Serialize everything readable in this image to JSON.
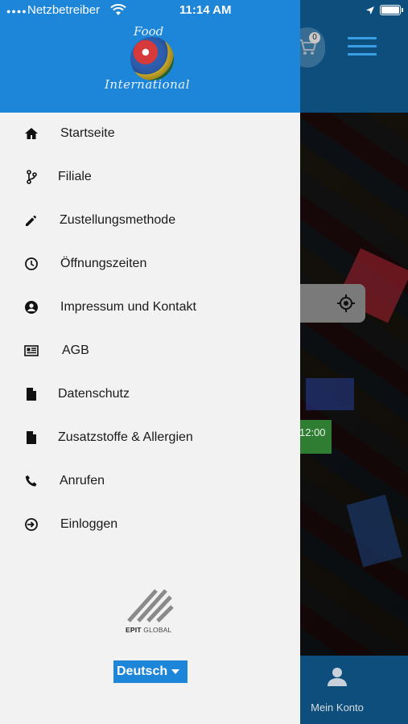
{
  "status_bar": {
    "carrier": "Netzbetreiber",
    "time": "11:14 AM"
  },
  "brand": {
    "logo_top": "Food",
    "logo_bottom": "International"
  },
  "menu": {
    "items": [
      {
        "label": "Startseite",
        "icon": "home-icon"
      },
      {
        "label": "Filiale",
        "icon": "branch-icon"
      },
      {
        "label": "Zustellungsmethode",
        "icon": "pencil-icon"
      },
      {
        "label": "Öffnungszeiten",
        "icon": "clock-icon"
      },
      {
        "label": "Impressum und Kontakt",
        "icon": "account-circle-icon"
      },
      {
        "label": "AGB",
        "icon": "newspaper-icon"
      },
      {
        "label": "Datenschutz",
        "icon": "document-icon"
      },
      {
        "label": "Zusatzstoffe & Allergien",
        "icon": "document-icon"
      },
      {
        "label": "Anrufen",
        "icon": "phone-icon"
      },
      {
        "label": "Einloggen",
        "icon": "login-icon"
      }
    ]
  },
  "footer": {
    "company_bold": "EPIT",
    "company_rest": " GLOBAL",
    "language": "Deutsch"
  },
  "background_app": {
    "cart_count": "0",
    "time_badge": "12:00",
    "account_label": "Mein Konto"
  },
  "colors": {
    "drawer_header": "#1e86d8",
    "drawer_bg": "#f2f2f2",
    "bottom_bar": "#0d4e7c",
    "hamburger": "#3aa0e6"
  }
}
